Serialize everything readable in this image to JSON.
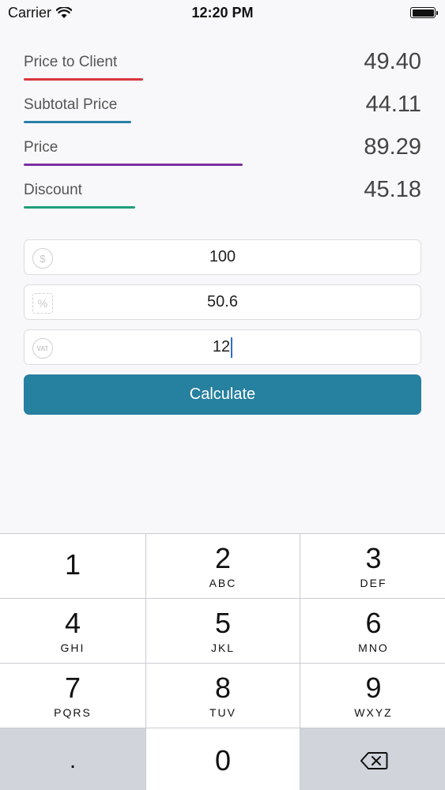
{
  "status": {
    "carrier": "Carrier",
    "time": "12:20 PM"
  },
  "results": [
    {
      "label": "Price to Client",
      "value": "49.40",
      "color": "#d9363e",
      "bar_fraction": 0.3
    },
    {
      "label": "Subtotal Price",
      "value": "44.11",
      "color": "#2a7fa8",
      "bar_fraction": 0.27
    },
    {
      "label": "Price",
      "value": "89.29",
      "color": "#7a2fa0",
      "bar_fraction": 0.55
    },
    {
      "label": "Discount",
      "value": "45.18",
      "color": "#1f9e7a",
      "bar_fraction": 0.28
    }
  ],
  "inputs": [
    {
      "icon": "dollar-icon",
      "glyph": "$",
      "value": "100"
    },
    {
      "icon": "percent-tag-icon",
      "glyph": "%",
      "value": "50.6"
    },
    {
      "icon": "vat-icon",
      "glyph": "VAT",
      "value": "12"
    }
  ],
  "calculate_label": "Calculate",
  "keypad": {
    "keys": [
      {
        "num": "1",
        "letters": ""
      },
      {
        "num": "2",
        "letters": "ABC"
      },
      {
        "num": "3",
        "letters": "DEF"
      },
      {
        "num": "4",
        "letters": "GHI"
      },
      {
        "num": "5",
        "letters": "JKL"
      },
      {
        "num": "6",
        "letters": "MNO"
      },
      {
        "num": "7",
        "letters": "PQRS"
      },
      {
        "num": "8",
        "letters": "TUV"
      },
      {
        "num": "9",
        "letters": "WXYZ"
      }
    ],
    "dot": ".",
    "zero": "0"
  }
}
